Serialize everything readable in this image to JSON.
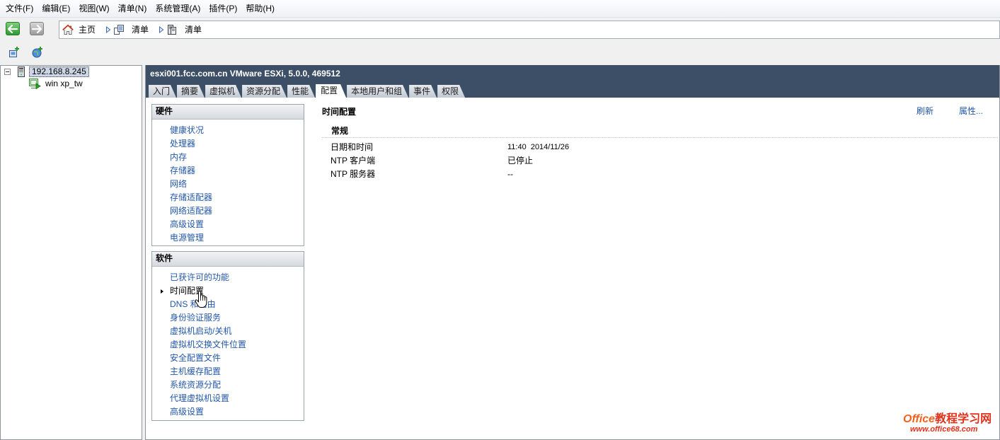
{
  "colors": {
    "header_bg": "#3d4f66",
    "link": "#2357a8",
    "selection_bg": "#cdd6e6",
    "watermark": "#e2321b"
  },
  "menu": {
    "items": [
      "文件(F)",
      "编辑(E)",
      "视图(W)",
      "清单(N)",
      "系统管理(A)",
      "插件(P)",
      "帮助(H)"
    ]
  },
  "nav": {
    "back_icon": "back-arrow-icon",
    "forward_icon": "forward-arrow-icon",
    "breadcrumb": [
      {
        "icon": "home-icon",
        "label": "主页"
      },
      {
        "icon": "inventory-icon",
        "label": "清单"
      },
      {
        "icon": "hosts-clusters-icon",
        "label": "清单"
      }
    ]
  },
  "toolbar": {
    "buttons": [
      {
        "icon": "new-vm-icon"
      },
      {
        "icon": "new-resource-pool-icon"
      }
    ]
  },
  "tree": {
    "host": {
      "icon": "server-icon",
      "label": "192.168.8.245",
      "expanded": true
    },
    "vms": [
      {
        "icon": "vm-powered-on-icon",
        "label": "win xp_tw"
      }
    ]
  },
  "host_view": {
    "title": "esxi001.fcc.com.cn VMware ESXi, 5.0.0, 469512",
    "tabs": [
      "入门",
      "摘要",
      "虚拟机",
      "资源分配",
      "性能",
      "配置",
      "本地用户和组",
      "事件",
      "权限"
    ],
    "active_tab_index": 5
  },
  "config_nav": {
    "hardware": {
      "title": "硬件",
      "items": [
        "健康状况",
        "处理器",
        "内存",
        "存储器",
        "网络",
        "存储适配器",
        "网络适配器",
        "高级设置",
        "电源管理"
      ]
    },
    "software": {
      "title": "软件",
      "items": [
        "已获许可的功能",
        "时间配置",
        "DNS 和路由",
        "身份验证服务",
        "虚拟机启动/关机",
        "虚拟机交换文件位置",
        "安全配置文件",
        "主机缓存配置",
        "系统资源分配",
        "代理虚拟机设置",
        "高级设置"
      ],
      "selected_index": 1
    }
  },
  "detail": {
    "title": "时间配置",
    "actions": {
      "refresh": "刷新",
      "properties": "属性..."
    },
    "section": "常规",
    "rows": [
      {
        "label": "日期和时间",
        "value": "11:40  2014/11/26"
      },
      {
        "label": "NTP 客户端",
        "value": "已停止"
      },
      {
        "label": "NTP 服务器",
        "value": "--"
      }
    ]
  },
  "watermark": {
    "brand": "Office",
    "site_name": "教程学习网",
    "url": "www.office68.com"
  }
}
